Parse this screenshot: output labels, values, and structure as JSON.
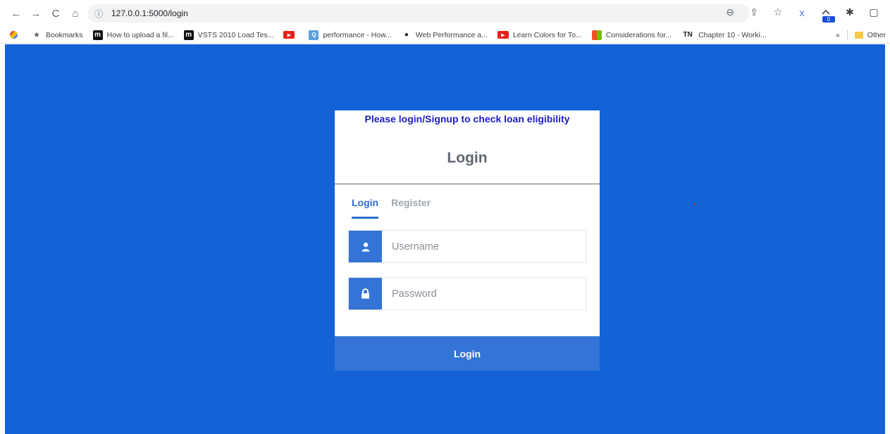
{
  "browser": {
    "url": "127.0.0.1:5000/login",
    "nav": {
      "back": "←",
      "forward": "→",
      "reload": "C",
      "home": "⌂"
    },
    "info_icon": "ⓘ",
    "extension_badge": "0",
    "right_icons": {
      "zoom": "⊖",
      "share": "⇪",
      "star": "☆",
      "ext_x": "x",
      "puzzle": "✱",
      "sidebar": "▢"
    }
  },
  "bookmarks": {
    "items": [
      {
        "label": "Bookmarks",
        "icon": "★"
      },
      {
        "label": "How to upload a fil...",
        "icon": "m"
      },
      {
        "label": "VSTS 2010 Load Tes...",
        "icon": "m"
      },
      {
        "label": "",
        "icon": "▶"
      },
      {
        "label": "performance - How...",
        "icon": "Q"
      },
      {
        "label": "Web Performance a...",
        "icon": "●"
      },
      {
        "label": "Learn Colors for To...",
        "icon": "▶"
      },
      {
        "label": "Considerations for...",
        "icon": "■"
      },
      {
        "label": "Chapter 10 - Worki...",
        "icon": "TN"
      }
    ],
    "more": "»",
    "other_label": "Other"
  },
  "login": {
    "notice": "Please login/Signup to check loan eligibility",
    "title": "Login",
    "tabs": [
      {
        "label": "Login"
      },
      {
        "label": "Register"
      }
    ],
    "username_placeholder": "Username",
    "password_placeholder": "Password",
    "submit_label": "Login"
  },
  "colors": {
    "page_background": "#1362d6",
    "accent": "#3374d6",
    "notice_text": "#1c1ccc"
  }
}
